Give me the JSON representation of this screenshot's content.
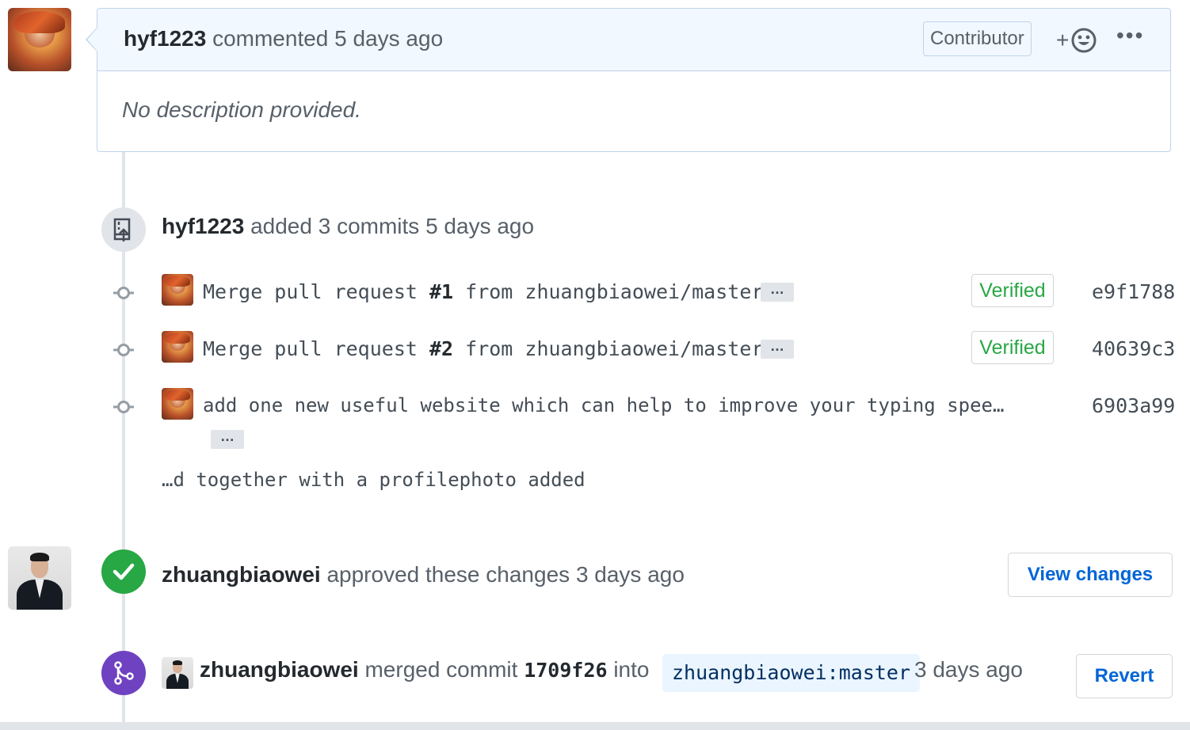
{
  "comment": {
    "author": "hyf1223",
    "action": "commented",
    "time": "5 days ago",
    "role_badge": "Contributor",
    "reaction_plus": "+",
    "more_label": "•••",
    "body": "No description provided."
  },
  "commits_event": {
    "author": "hyf1223",
    "action": "added 3 commits",
    "time": "5 days ago",
    "icon": "repo-push-icon"
  },
  "commits": [
    {
      "prefix": "Merge pull request ",
      "ref": "#1",
      "suffix": " from zhuangbiaowei/master",
      "verified": "Verified",
      "sha": "e9f1788"
    },
    {
      "prefix": "Merge pull request ",
      "ref": "#2",
      "suffix": " from zhuangbiaowei/master",
      "verified": "Verified",
      "sha": "40639c3"
    },
    {
      "message": "add one new useful website which can help to improve your typing spee…",
      "continuation": "…d together with a profilephoto added",
      "sha": "6903a99"
    }
  ],
  "ellipsis_label": "…",
  "review": {
    "author": "zhuangbiaowei",
    "action": "approved these changes",
    "time": "3 days ago",
    "button": "View changes",
    "status_color": "#28a745"
  },
  "merge": {
    "author": "zhuangbiaowei",
    "action": "merged commit",
    "sha": "1709f26",
    "into": "into",
    "branch": "zhuangbiaowei:master",
    "time": "3 days ago",
    "button": "Revert",
    "status_color": "#6f42c1"
  }
}
